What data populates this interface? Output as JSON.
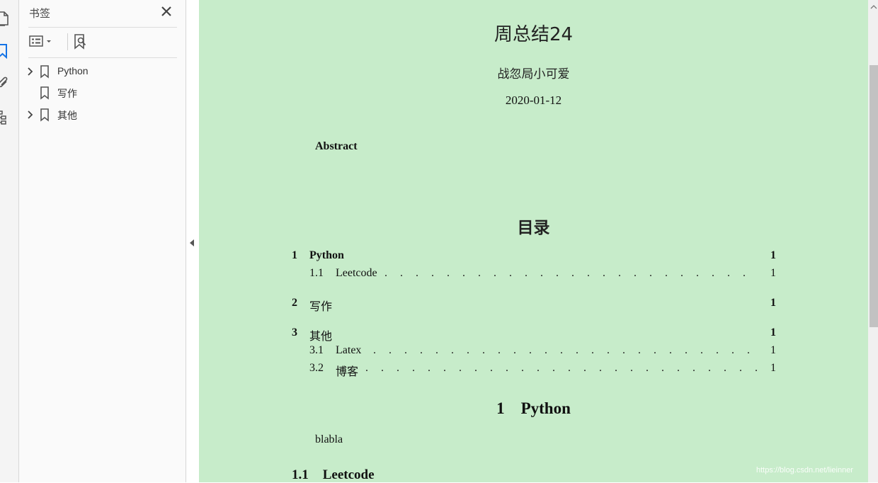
{
  "sidebar": {
    "title": "书签",
    "bookmarks": [
      {
        "label": "Python",
        "expandable": true
      },
      {
        "label": "写作",
        "expandable": false
      },
      {
        "label": "其他",
        "expandable": true
      }
    ]
  },
  "document": {
    "title": "周总结24",
    "author": "战忽局小可爱",
    "date": "2020-01-12",
    "abstract_label": "Abstract",
    "toc_heading": "目录",
    "toc": [
      {
        "num": "1",
        "title": "Python",
        "page": "1",
        "level": 1
      },
      {
        "num": "1.1",
        "title": "Leetcode",
        "page": "1",
        "level": 2
      },
      {
        "num": "2",
        "title": "写作",
        "page": "1",
        "level": 1
      },
      {
        "num": "3",
        "title": "其他",
        "page": "1",
        "level": 1
      },
      {
        "num": "3.1",
        "title": "Latex",
        "page": "1",
        "level": 2
      },
      {
        "num": "3.2",
        "title": "博客",
        "page": "1",
        "level": 2
      }
    ],
    "section1": {
      "num": "1",
      "title": "Python"
    },
    "body_text": "blabla",
    "subsection": {
      "num": "1.1",
      "title": "Leetcode"
    }
  },
  "watermark": "https://blog.csdn.net/lieinner",
  "colors": {
    "page_background": "#c7ecca",
    "accent_blue": "#1473e6"
  }
}
